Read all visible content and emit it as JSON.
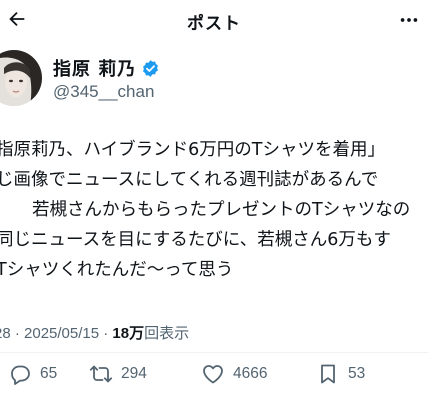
{
  "header": {
    "title": "ポスト",
    "back_icon": "back-arrow-icon",
    "more_icon": "more-icon"
  },
  "author": {
    "display_name": "指原 莉乃",
    "handle": "@345__chan",
    "verified": true,
    "verified_color": "#1d9bf0"
  },
  "post": {
    "lines": [
      "指原莉乃、ハイブランド6万円のTシャツを着用」",
      "じ画像でニュースにしてくれる週刊誌があるんで",
      "若槻さんからもらったプレゼントのTシャツなの",
      "同じニュースを目にするたびに、若槻さん6万もす",
      "Tシャツくれたんだ〜って思う"
    ]
  },
  "meta": {
    "time_date": "28 · 2025/05/15 · ",
    "views_count": "18万",
    "views_label": "回表示"
  },
  "actions": {
    "reply_count": "65",
    "repost_count": "294",
    "like_count": "4666",
    "bookmark_count": "53"
  }
}
